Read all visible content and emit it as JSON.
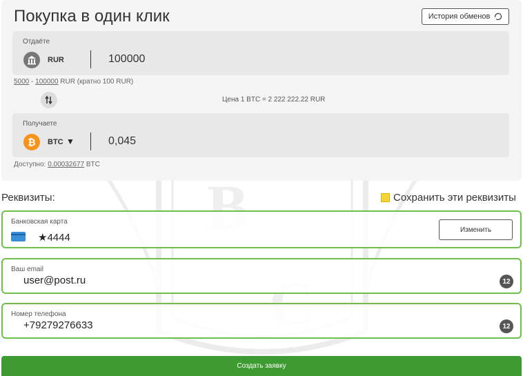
{
  "page": {
    "title": "Покупка в один клик",
    "history_button": "История обменов"
  },
  "give": {
    "label": "Отдаёте",
    "currency": "RUR",
    "amount": "100000",
    "icon": "bank-icon"
  },
  "limits": {
    "min": "5000",
    "separator": " - ",
    "max": "100000",
    "suffix": " RUR (кратно 100 RUR)"
  },
  "price": "Цена 1 BTC = 2 222 222.22 RUR",
  "get": {
    "label": "Получаете",
    "currency": "BTC",
    "amount": "0,045",
    "icon": "bitcoin-icon"
  },
  "available": {
    "label": "Доступно: ",
    "amount": "0.00032677",
    "unit": " BTC"
  },
  "requisites": {
    "title": "Реквизиты:",
    "save_label": "Сохранить эти реквизиты",
    "save_checked": true
  },
  "fields": {
    "card": {
      "label": "Банковская карта",
      "value": "★4444",
      "button": "Изменить",
      "icon": "bank-card-icon"
    },
    "email": {
      "label": "Ваш email",
      "value": "user@post.ru",
      "badge": "12"
    },
    "phone": {
      "label": "Номер телефона",
      "value": "+79279276633",
      "badge": "12"
    }
  },
  "submit_button": "Создать заявку",
  "colors": {
    "accent_green": "#3e9b32",
    "field_border": "#6cc04a",
    "checkbox": "#f5d33a",
    "bitcoin": "#f7931a"
  }
}
